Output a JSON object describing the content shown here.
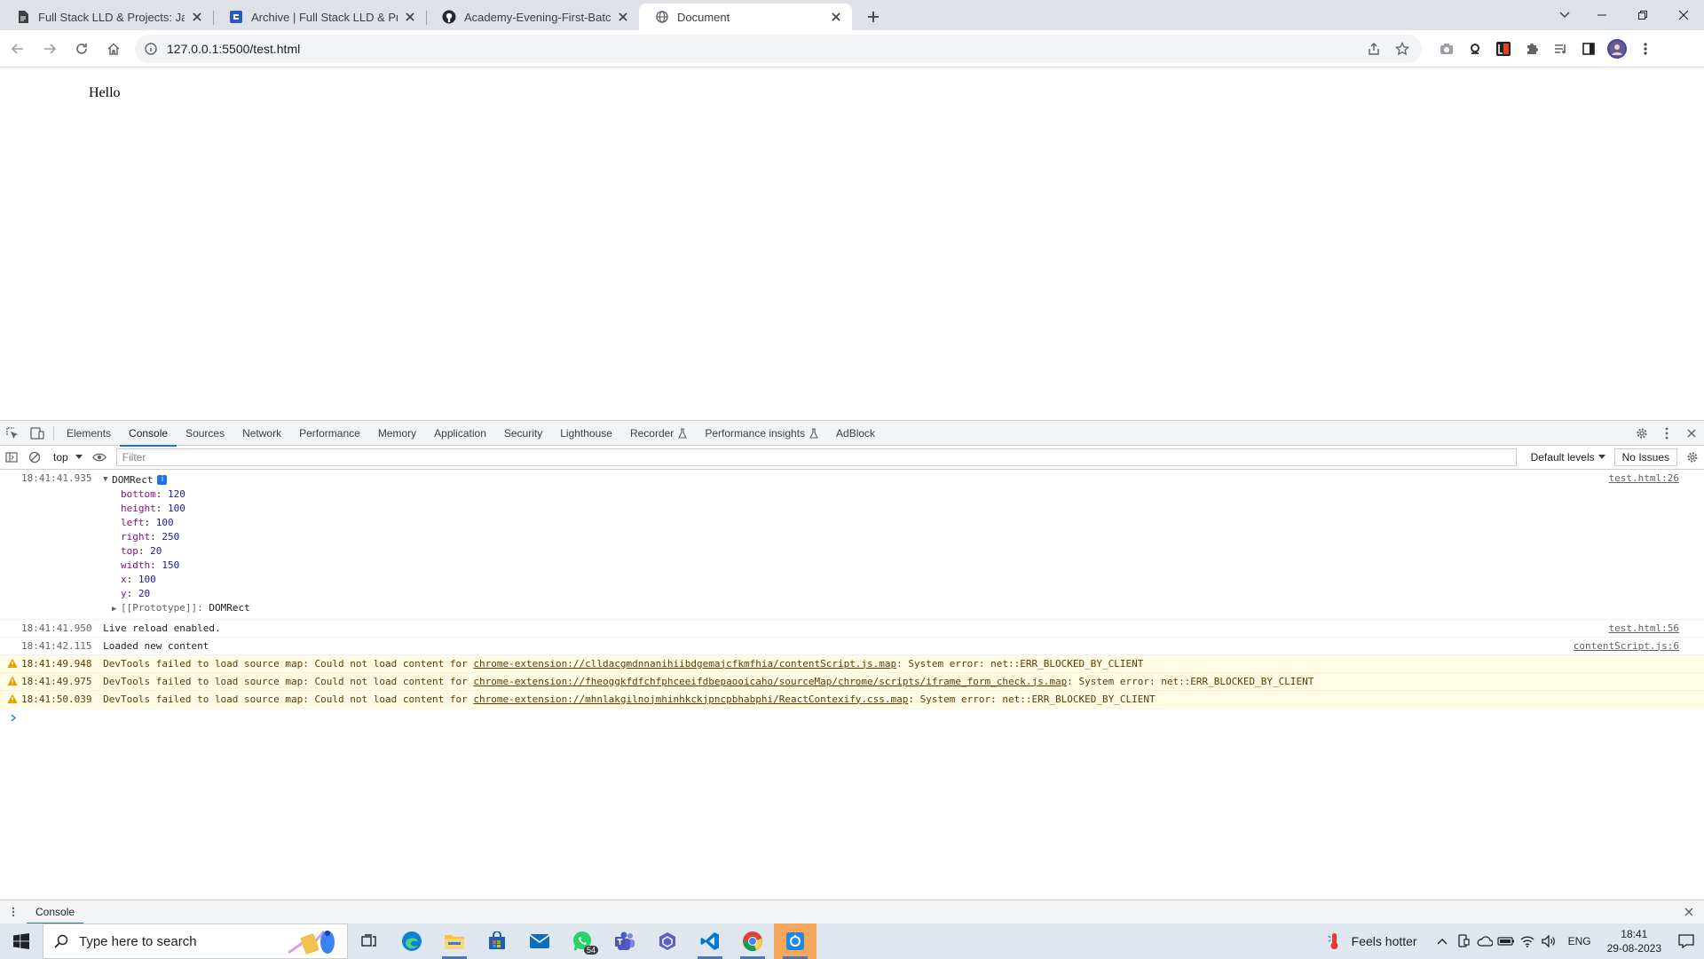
{
  "browser": {
    "tabs": [
      {
        "title": "Full Stack LLD & Projects: JavaScript",
        "icon": "document-icon",
        "active": false
      },
      {
        "title": "Archive | Full Stack LLD & Projects",
        "icon": "scaler-icon",
        "active": false
      },
      {
        "title": "Academy-Evening-First-Batch--Full",
        "icon": "github-icon",
        "active": false
      },
      {
        "title": "Document",
        "icon": "globe-icon",
        "active": true
      }
    ],
    "url": "127.0.0.1:5500/test.html"
  },
  "page": {
    "text": "Hello"
  },
  "devtools": {
    "tabs": [
      "Elements",
      "Console",
      "Sources",
      "Network",
      "Performance",
      "Memory",
      "Application",
      "Security",
      "Lighthouse",
      "Recorder",
      "Performance insights",
      "AdBlock"
    ],
    "active_tab": "Console",
    "toolbar": {
      "context": "top",
      "filter_placeholder": "Filter",
      "levels": "Default levels",
      "issues": "No Issues"
    },
    "console": {
      "object_entry": {
        "timestamp": "18:41:41.935",
        "label": "DOMRect",
        "source": "test.html:26",
        "props": [
          {
            "key": "bottom",
            "value": "120"
          },
          {
            "key": "height",
            "value": "100"
          },
          {
            "key": "left",
            "value": "100"
          },
          {
            "key": "right",
            "value": "250"
          },
          {
            "key": "top",
            "value": "20"
          },
          {
            "key": "width",
            "value": "150"
          },
          {
            "key": "x",
            "value": "100"
          },
          {
            "key": "y",
            "value": "20"
          }
        ],
        "prototype_key": "[[Prototype]]",
        "prototype_value": "DOMRect"
      },
      "log1": {
        "timestamp": "18:41:41.950",
        "message": "Live reload enabled.",
        "source": "test.html:56"
      },
      "log2": {
        "timestamp": "18:41:42.115",
        "message": "Loaded new content",
        "source": "contentScript.js:6"
      },
      "warnings": [
        {
          "timestamp": "18:41:49.948",
          "prefix": "DevTools failed to load source map: Could not load content for",
          "link": "chrome-extension://clldacgmdnnanihiibdgemajcfkmfhia/contentScript.js.map",
          "suffix": ": System error: net::ERR_BLOCKED_BY_CLIENT"
        },
        {
          "timestamp": "18:41:49.975",
          "prefix": "DevTools failed to load source map: Could not load content for",
          "link": "chrome-extension://fheoggkfdfchfphceeifdbepaooicaho/sourceMap/chrome/scripts/iframe_form_check.js.map",
          "suffix": ": System error: net::ERR_BLOCKED_BY_CLIENT"
        },
        {
          "timestamp": "18:41:50.039",
          "prefix": "DevTools failed to load source map: Could not load content for",
          "link": "chrome-extension://mhnlakgilnojmhinhkckjpncpbhabphi/ReactContexify.css.map",
          "suffix": ": System error: net::ERR_BLOCKED_BY_CLIENT"
        }
      ]
    },
    "drawer_tab": "Console"
  },
  "taskbar": {
    "search_placeholder": "Type here to search",
    "whatsapp_badge": "54",
    "weather": "Feels hotter",
    "language": "ENG",
    "time": "18:41",
    "date": "29-08-2023"
  },
  "colors": {
    "accent": "#1a73e8",
    "warning_bg": "#fffbe5",
    "taskbar_bg": "#e0e6ee"
  }
}
